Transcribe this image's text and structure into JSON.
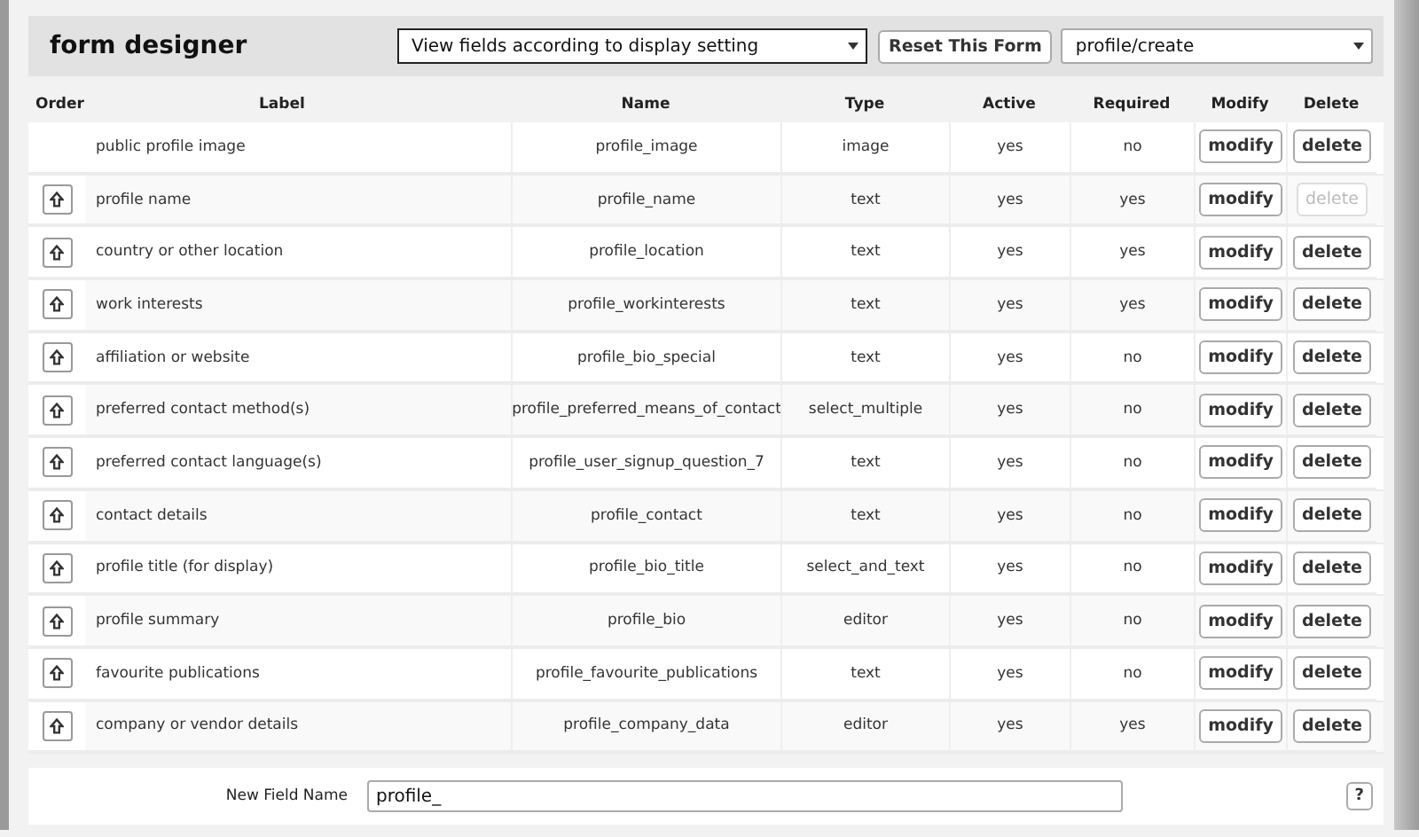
{
  "header": {
    "title": "form designer",
    "view_select": "View fields according to display setting",
    "reset_button": "Reset This Form",
    "form_select": "profile/create"
  },
  "table": {
    "columns": [
      "Order",
      "Label",
      "Name",
      "Type",
      "Active",
      "Required",
      "Modify",
      "Delete"
    ],
    "rows": [
      {
        "movable": false,
        "label": "public profile image",
        "name": "profile_image",
        "type": "image",
        "active": "yes",
        "required": "no",
        "modify": "modify",
        "delete": "delete",
        "delete_disabled": false
      },
      {
        "movable": true,
        "label": "profile name",
        "name": "profile_name",
        "type": "text",
        "active": "yes",
        "required": "yes",
        "modify": "modify",
        "delete": "delete",
        "delete_disabled": true
      },
      {
        "movable": true,
        "label": "country or other location",
        "name": "profile_location",
        "type": "text",
        "active": "yes",
        "required": "yes",
        "modify": "modify",
        "delete": "delete",
        "delete_disabled": false
      },
      {
        "movable": true,
        "label": "work interests",
        "name": "profile_workinterests",
        "type": "text",
        "active": "yes",
        "required": "yes",
        "modify": "modify",
        "delete": "delete",
        "delete_disabled": false
      },
      {
        "movable": true,
        "label": "affiliation or website",
        "name": "profile_bio_special",
        "type": "text",
        "active": "yes",
        "required": "no",
        "modify": "modify",
        "delete": "delete",
        "delete_disabled": false
      },
      {
        "movable": true,
        "label": "preferred contact method(s)",
        "name": "profile_preferred_means_of_contact",
        "type": "select_multiple",
        "active": "yes",
        "required": "no",
        "modify": "modify",
        "delete": "delete",
        "delete_disabled": false
      },
      {
        "movable": true,
        "label": "preferred contact language(s)",
        "name": "profile_user_signup_question_7",
        "type": "text",
        "active": "yes",
        "required": "no",
        "modify": "modify",
        "delete": "delete",
        "delete_disabled": false
      },
      {
        "movable": true,
        "label": "contact details",
        "name": "profile_contact",
        "type": "text",
        "active": "yes",
        "required": "no",
        "modify": "modify",
        "delete": "delete",
        "delete_disabled": false
      },
      {
        "movable": true,
        "label": "profile title (for display)",
        "name": "profile_bio_title",
        "type": "select_and_text",
        "active": "yes",
        "required": "no",
        "modify": "modify",
        "delete": "delete",
        "delete_disabled": false
      },
      {
        "movable": true,
        "label": "profile summary",
        "name": "profile_bio",
        "type": "editor",
        "active": "yes",
        "required": "no",
        "modify": "modify",
        "delete": "delete",
        "delete_disabled": false
      },
      {
        "movable": true,
        "label": " favourite publications",
        "name": "profile_favourite_publications",
        "type": "text",
        "active": "yes",
        "required": "no",
        "modify": "modify",
        "delete": "delete",
        "delete_disabled": false
      },
      {
        "movable": true,
        "label": "company or vendor details",
        "name": "profile_company_data",
        "type": "editor",
        "active": "yes",
        "required": "yes",
        "modify": "modify",
        "delete": "delete",
        "delete_disabled": false
      }
    ]
  },
  "new_field": {
    "label": "New Field Name",
    "value": "profile_",
    "help_button": "?"
  }
}
